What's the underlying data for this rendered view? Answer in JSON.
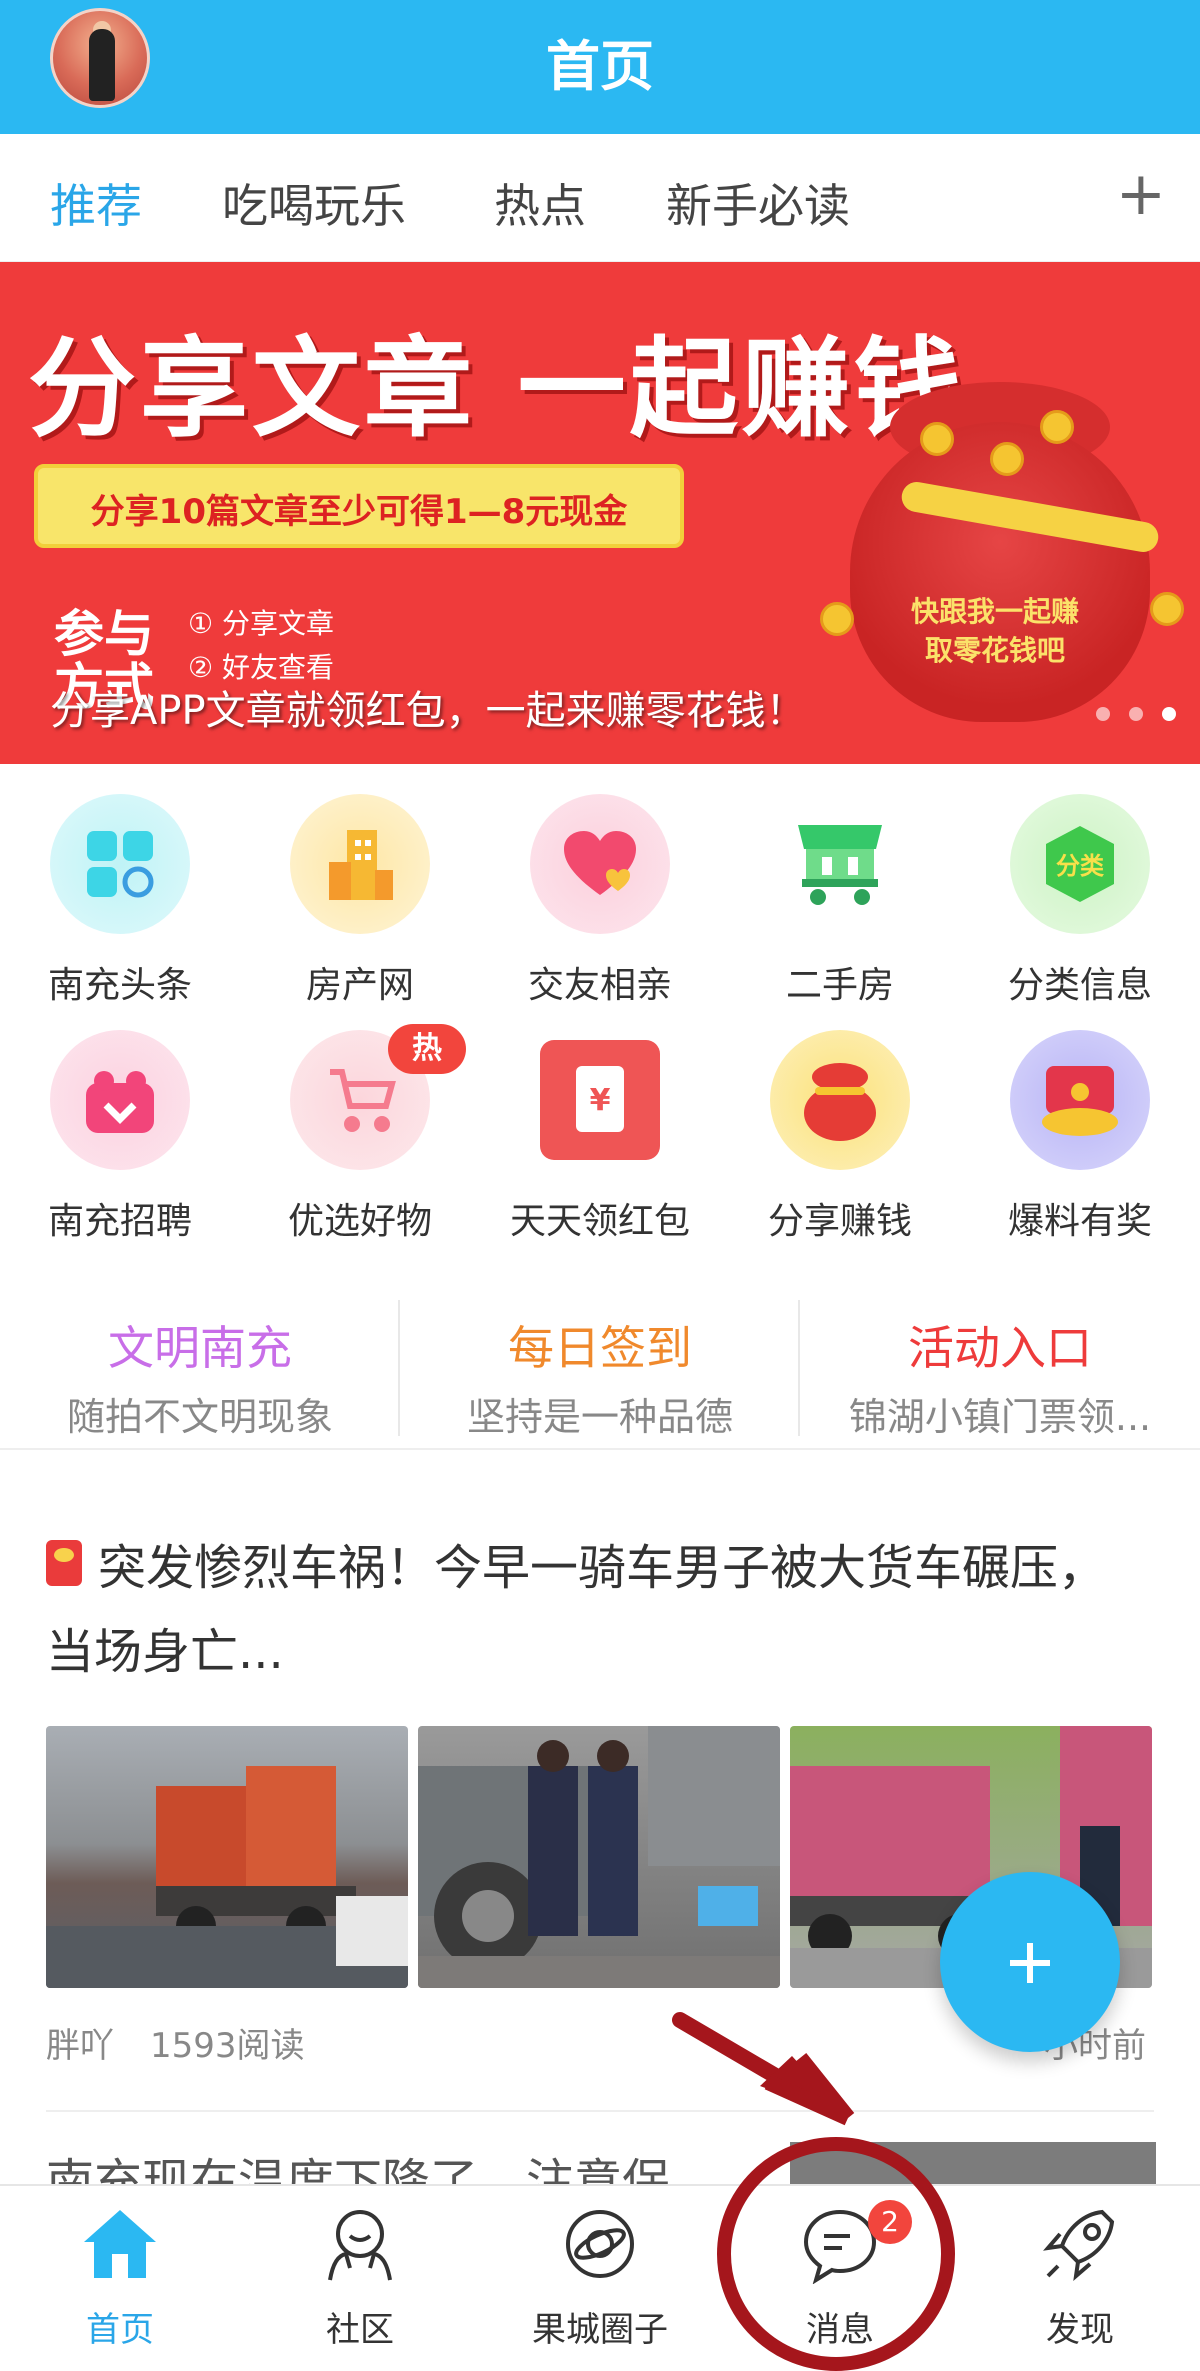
{
  "header": {
    "title": "首页"
  },
  "tabs": [
    {
      "label": "推荐",
      "active": true
    },
    {
      "label": "吃喝玩乐"
    },
    {
      "label": "热点"
    },
    {
      "label": "新手必读"
    }
  ],
  "tab_add_label": "+",
  "banner": {
    "headline": "分享文章 一起赚钱",
    "scroll_text": "分享10篇文章至少可得1—8元现金",
    "steps_title": "参与方式",
    "steps": [
      "① 分享文章",
      "② 好友查看"
    ],
    "bag_text": "快跟我一起赚取零花钱吧",
    "caption": "分享APP文章就领红包，一起来赚零花钱！",
    "slide_count": 3,
    "active_slide": 2
  },
  "grid": [
    {
      "label": "南充头条",
      "icon": "grid-apps-icon",
      "color": "#3dd5e6"
    },
    {
      "label": "房产网",
      "icon": "building-icon",
      "color": "#f6b833"
    },
    {
      "label": "交友相亲",
      "icon": "heart-icon",
      "color": "#f24a6e"
    },
    {
      "label": "二手房",
      "icon": "market-stall-icon",
      "color": "#35c86a"
    },
    {
      "label": "分类信息",
      "icon": "category-badge-icon",
      "color": "#3fc84c",
      "badge_text": "分类"
    },
    {
      "label": "南充招聘",
      "icon": "recruit-icon",
      "color": "#f2457a"
    },
    {
      "label": "优选好物",
      "icon": "stroller-icon",
      "color": "#f57b8e",
      "hot": "热"
    },
    {
      "label": "天天领红包",
      "icon": "red-envelope-icon",
      "color": "#ef5555"
    },
    {
      "label": "分享赚钱",
      "icon": "money-bag-icon",
      "color": "#e53c36"
    },
    {
      "label": "爆料有奖",
      "icon": "gift-box-icon",
      "color": "#e3364b"
    }
  ],
  "quick_links": [
    {
      "title": "文明南充",
      "subtitle": "随拍不文明现象",
      "color": "#c86ee8"
    },
    {
      "title": "每日签到",
      "subtitle": "坚持是一种品德",
      "color": "#f0892c"
    },
    {
      "title": "活动入口",
      "subtitle": "锦湖小镇门票领...",
      "color": "#ee3b3b"
    }
  ],
  "article": {
    "title": "突发惨烈车祸！今早一骑车男子被大货车碾压，当场身亡...",
    "author": "胖吖",
    "reads": "1593阅读",
    "time": "小时前"
  },
  "next_article": {
    "title": "南充现在温度下降了，注意保"
  },
  "fab_label": "+",
  "bottom_nav": [
    {
      "label": "首页",
      "icon": "home-icon",
      "active": true
    },
    {
      "label": "社区",
      "icon": "community-icon"
    },
    {
      "label": "果城圈子",
      "icon": "planet-circle-icon"
    },
    {
      "label": "消息",
      "icon": "message-icon",
      "badge": "2"
    },
    {
      "label": "发现",
      "icon": "rocket-icon"
    }
  ],
  "colors": {
    "brand": "#2bb8f2",
    "tab_active": "#2aa6e8",
    "banner_red": "#ef3b3b",
    "annotation": "#a5161c"
  }
}
